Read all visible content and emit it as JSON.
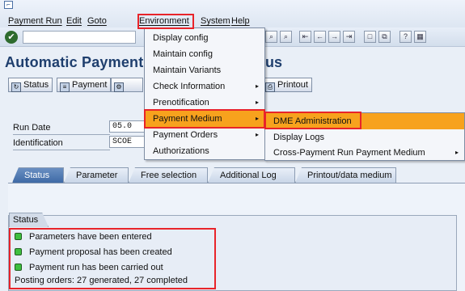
{
  "menubar": {
    "items": [
      "Payment Run",
      "Edit",
      "Goto",
      "Environment",
      "System",
      "Help"
    ]
  },
  "page_title": "Automatic Payment",
  "page_title_tail": "tus",
  "app_toolbar": {
    "status_label": "Status",
    "payment_label": "Payment",
    "printout_label": "Printout"
  },
  "fields": {
    "run_date_label": "Run Date",
    "run_date_value": "05.0",
    "identification_label": "Identification",
    "identification_value": "SCOE"
  },
  "tabs": [
    "Status",
    "Parameter",
    "Free selection",
    "Additional Log",
    "Printout/data medium"
  ],
  "status_group": {
    "title": "Status",
    "messages": [
      "Parameters have been entered",
      "Payment proposal has been created",
      "Payment run has been carried out"
    ],
    "summary": "Posting orders: 27 generated, 27 completed"
  },
  "environment_menu": {
    "items": [
      {
        "label": "Display config",
        "has_submenu": false
      },
      {
        "label": "Maintain config",
        "has_submenu": false
      },
      {
        "label": "Maintain Variants",
        "has_submenu": false
      },
      {
        "label": "Check Information",
        "has_submenu": true
      },
      {
        "label": "Prenotification",
        "has_submenu": true
      },
      {
        "label": "Payment Medium",
        "has_submenu": true
      },
      {
        "label": "Payment Orders",
        "has_submenu": true
      },
      {
        "label": "Authorizations",
        "has_submenu": false
      }
    ],
    "selected": "Payment Medium"
  },
  "payment_medium_submenu": {
    "items": [
      {
        "label": "DME Administration",
        "has_submenu": false
      },
      {
        "label": "Display Logs",
        "has_submenu": false
      },
      {
        "label": "Cross-Payment Run Payment Medium",
        "has_submenu": true
      }
    ],
    "selected": "DME Administration"
  },
  "colors": {
    "highlight": "#e8242a",
    "menu_selection": "#f7a21d",
    "status_led": "#3fbf3f",
    "active_tab": "#3e6aa6"
  }
}
